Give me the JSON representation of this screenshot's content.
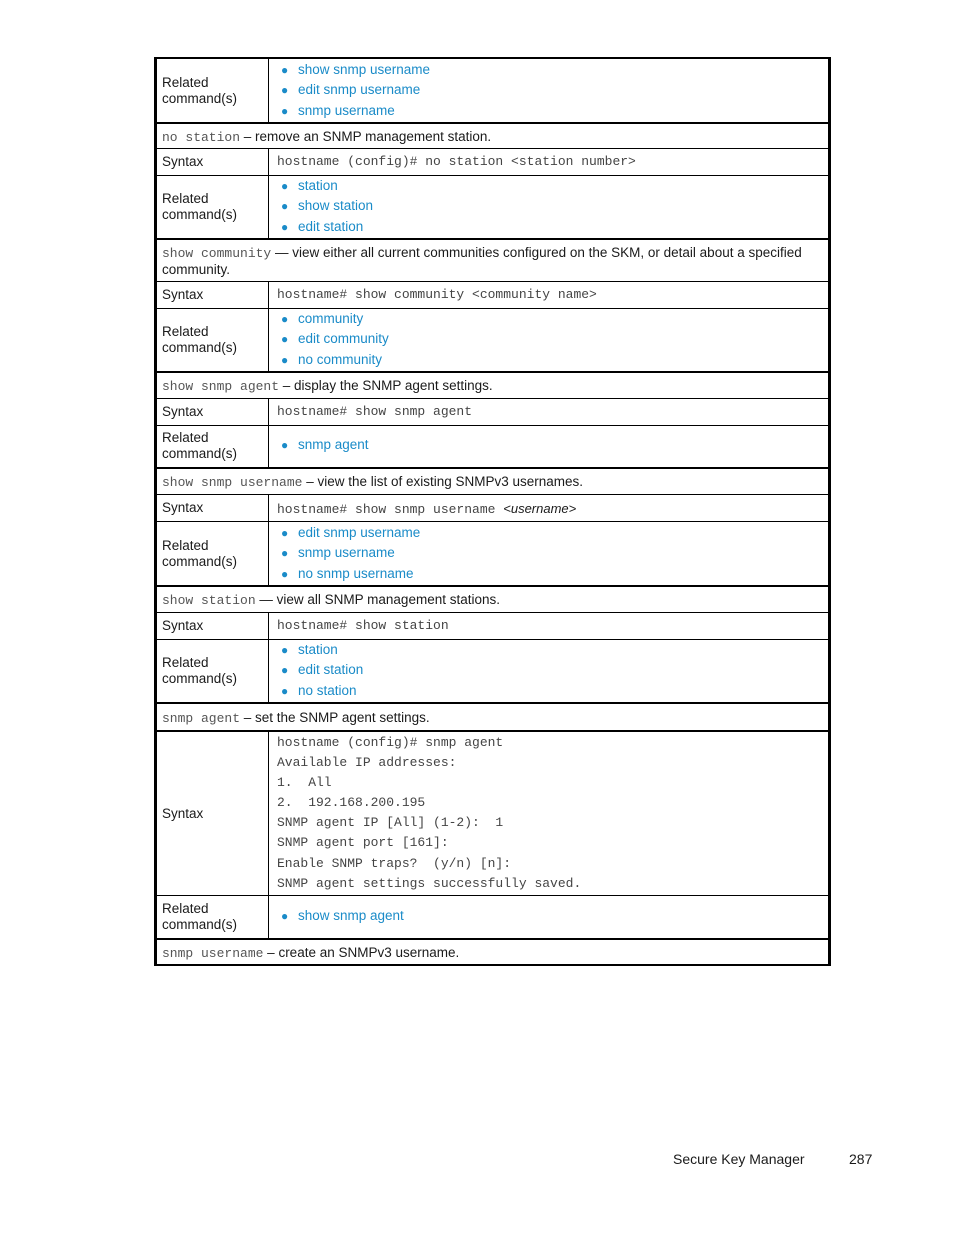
{
  "labels": {
    "related": "Related command(s)",
    "related_line1": "Related",
    "related_line2": "command(s)",
    "syntax": "Syntax"
  },
  "sections": [
    {
      "id": "prev-tail",
      "related": [
        "show snmp username",
        "edit snmp username",
        "snmp username"
      ]
    },
    {
      "id": "no-station",
      "command": "no station",
      "separator": " – ",
      "description": "remove an SNMP management station.",
      "syntax": "hostname (config)# no station <station number>",
      "related": [
        "station",
        "show station",
        "edit station"
      ]
    },
    {
      "id": "show-community",
      "command": "show community",
      "separator": " — ",
      "description": "view either all current communities configured on the SKM, or detail about a specified community.",
      "syntax": "hostname# show community <community name>",
      "related": [
        "community",
        "edit community",
        "no community"
      ]
    },
    {
      "id": "show-snmp-agent",
      "command": "show snmp agent",
      "separator": " – ",
      "description": "display the SNMP agent settings.",
      "syntax": "hostname# show snmp agent",
      "related": [
        "snmp agent"
      ]
    },
    {
      "id": "show-snmp-username",
      "command": "show snmp username",
      "separator": " – ",
      "description": "view the list of existing SNMPv3 usernames.",
      "syntax": "hostname# show snmp username ",
      "syntax_arg": "<username>",
      "related": [
        "edit snmp username",
        "snmp username",
        "no snmp username"
      ]
    },
    {
      "id": "show-station",
      "command": "show station",
      "separator": " — ",
      "description": "view all SNMP management stations.",
      "syntax": "hostname# show station",
      "related": [
        "station",
        "edit station",
        "no station"
      ]
    },
    {
      "id": "snmp-agent",
      "command": "snmp agent",
      "separator": " – ",
      "description": "set the SNMP agent settings.",
      "syntax_lines": [
        "hostname (config)# snmp agent",
        "Available IP addresses:",
        "1.  All",
        "2.  192.168.200.195",
        "SNMP agent IP [All] (1-2):  1",
        "SNMP agent port [161]:",
        "Enable SNMP traps?  (y/n) [n]:",
        "SNMP agent settings successfully saved."
      ],
      "related": [
        "show snmp agent"
      ]
    },
    {
      "id": "snmp-username",
      "command": "snmp username",
      "separator": " – ",
      "description": "create an SNMPv3 username."
    }
  ],
  "footer": {
    "title": "Secure Key Manager",
    "page": "287"
  },
  "colors": {
    "link": "#1a8bc8",
    "border": "#000000",
    "mono_text": "#555555"
  }
}
